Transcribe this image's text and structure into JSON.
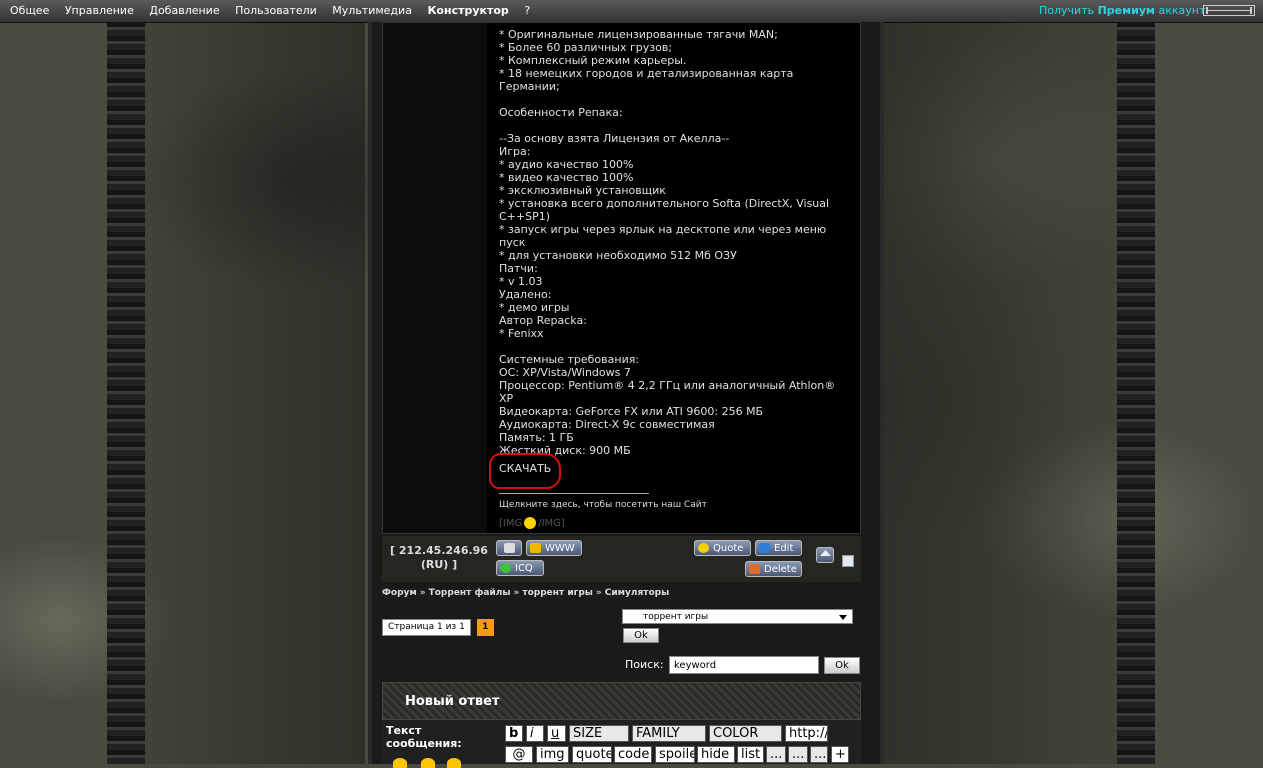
{
  "topbar": {
    "nav": [
      "Общее",
      "Управление",
      "Добавление",
      "Пользователи",
      "Мультимедиа",
      "Конструктор",
      "?"
    ],
    "premium_prefix": "Получить",
    "premium_bold": "Премиум",
    "premium_suffix": "аккаунт"
  },
  "post": {
    "text": "* Оригинальные лицензированные тягачи MAN;\n* Более 60 различных грузов;\n* Комплексный режим карьеры.\n* 18 немецких городов и детализированная карта Германии;\n\nОсобенности Репака:\n\n--За основу взята Лицензия от Акелла--\nИгра:\n* аудио качество 100%\n* видео качество 100%\n* эксклюзивный установщик\n* установка всего дополнительного Softa (DirectX, Visual C++SP1)\n* запуск игры через ярлык на десктопе или через меню пуск\n* для установки необходимо 512 Мб ОЗУ\nПатчи:\n* v 1.03\nУдалено:\n* демо игры\nАвтор Repacka:\n* Fenixx\n\nСистемные требования:\nОС: XP/Vista/Windows 7\nПроцессор: Pentium® 4 2,2 ГГц или аналогичный Athlon® XP\nВидеокарта: GeForce FX или ATI 9600: 256 МБ\nАудиокарта: Direct-X 9c совместимая\nПамять: 1 ГБ\nЖесткий диск: 900 МБ",
    "download_link": "СКАЧАТЬ",
    "signature": "Щелкните здесь, чтобы посетить наш Сайт",
    "img_open": "[IMG",
    "img_close": "/IMG]"
  },
  "post_footer": {
    "ip": "[ 212.45.246.96 (RU) ]",
    "www": "WWW",
    "icq": "ICQ",
    "quote": "Quote",
    "edit": "Edit",
    "delete": "Delete"
  },
  "breadcrumb": [
    "Форум",
    "Торрент файлы",
    "торрент игры",
    "Симуляторы"
  ],
  "breadcrumb_sep": "»",
  "pager": {
    "label": "Страница 1 из 1",
    "current": "1"
  },
  "jump": {
    "selected": "торрент игры",
    "ok": "Ok"
  },
  "search": {
    "label": "Поиск:",
    "value": "keyword",
    "ok": "Ok"
  },
  "reply": {
    "title": "Новый ответ",
    "message_label": "Текст сообщения:",
    "bbcodes_row1": [
      "b",
      "i",
      "u",
      "SIZE",
      "FAMILY",
      "COLOR",
      "http://"
    ],
    "bbcodes_row2": [
      "@",
      "img",
      "quote",
      "code",
      "spoiler",
      "hide",
      "list",
      "...",
      "...",
      "...",
      "+"
    ]
  },
  "colors": {
    "accent_premium": "#2ed3e0",
    "annotation_circle": "#d41010",
    "page_current": "#f39c12"
  }
}
